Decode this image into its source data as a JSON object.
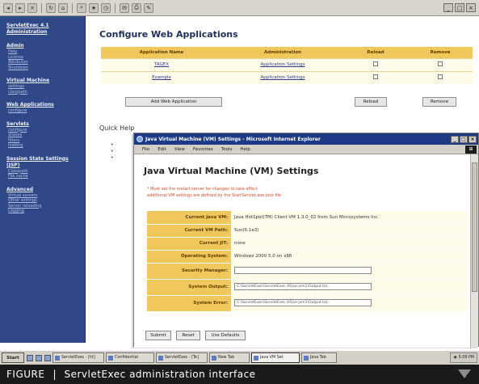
{
  "toolbar": {
    "buttons": [
      "back-icon",
      "forward-icon",
      "stop-icon",
      "refresh-icon",
      "home-icon",
      "search-icon",
      "favorites-icon",
      "history-icon",
      "mail-icon",
      "print-icon",
      "edit-icon"
    ],
    "window_controls": [
      "_",
      "□",
      "×"
    ]
  },
  "sidebar": {
    "groups": [
      {
        "head": "ServletExec 4.1 Administration",
        "links": []
      },
      {
        "head": "Admin",
        "links": [
          "Help",
          "License",
          "Attributes",
          "Shutdown"
        ]
      },
      {
        "head": "Virtual Machine",
        "links": [
          "settings",
          "classpath"
        ]
      },
      {
        "head": "Web Applications",
        "links": [
          "configure"
        ]
      },
      {
        "head": "Servlets",
        "links": [
          "configure",
          "aliases",
          "filters",
          "loading"
        ]
      },
      {
        "head": "Session State Settings (JSP)",
        "links": [
          "Classpath",
          "File cache"
        ]
      },
      {
        "head": "Advanced",
        "links": [
          "Virtual servers",
          "Other settings",
          "Server reloading",
          "Logging"
        ]
      }
    ]
  },
  "main": {
    "title": "Configure Web Applications",
    "table": {
      "headers": [
        "Application Name",
        "Administration",
        "Reload",
        "Remove"
      ],
      "rows": [
        {
          "name": "TAGEX",
          "admin": "Application Settings"
        },
        {
          "name": "Example",
          "admin": "Application Settings"
        }
      ]
    },
    "add_button": "Add Web Application",
    "reload_button": "Reload",
    "remove_button": "Remove",
    "quick_help": "Quick Help"
  },
  "popup": {
    "window_title": "Java Virtual Machine (VM) Settings - Microsoft Internet Explorer",
    "menu": [
      "File",
      "Edit",
      "View",
      "Favorites",
      "Tools",
      "Help"
    ],
    "heading": "Java Virtual Machine (VM) Settings",
    "notes": [
      "* Must set the restart server for changes to take effect",
      "additional VM settings are defined by the StartServlet.exe.lock file"
    ],
    "props": [
      {
        "label": "Current Java VM:",
        "value": "Java HotSpot(TM) Client VM 1.3.0_02 from Sun Microsystems Inc."
      },
      {
        "label": "Current VM Path:",
        "value": "Sun(5.1e3)"
      },
      {
        "label": "Current JIT:",
        "value": "none"
      },
      {
        "label": "Operating System:",
        "value": "Windows 2000 5.0 on x86"
      },
      {
        "label": "Security Manager:",
        "value": ""
      },
      {
        "label": "System Output:",
        "value": "C:\\ServletExec\\ServletExec AS\\se-jvm1\\Output.txt"
      },
      {
        "label": "System Error:",
        "value": "C:\\ServletExec\\ServletExec AS\\se-jvm1\\Output.txt"
      }
    ],
    "buttons": [
      "Submit",
      "Reset",
      "Use Defaults"
    ]
  },
  "taskbar": {
    "start": "Start",
    "tasks": [
      "ServletExec - [ht]",
      "Confidential",
      "ServletExec - [Te]",
      "New Tab",
      "Java VM Set",
      "Java Tab"
    ],
    "active_index": 4,
    "tray": "5:09 PM"
  },
  "caption": {
    "label": "FIGURE",
    "text": "ServletExec administration interface"
  }
}
